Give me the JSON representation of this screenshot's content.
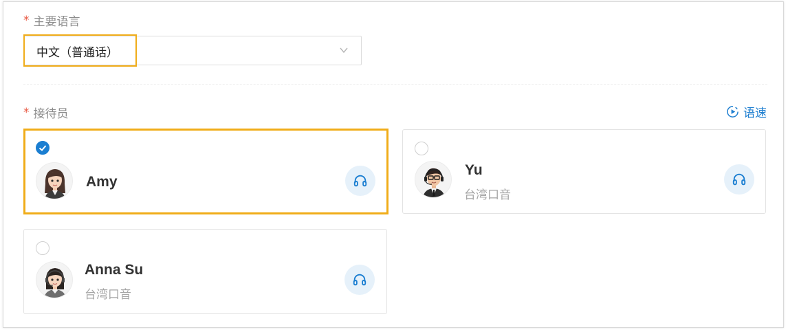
{
  "language": {
    "label": "主要语言",
    "required_mark": "*",
    "selected": "中文（普通话）"
  },
  "receptionist": {
    "label": "接待员",
    "required_mark": "*",
    "speed_label": "语速",
    "agents": [
      {
        "name": "Amy",
        "accent": "",
        "selected": true
      },
      {
        "name": "Yu",
        "accent": "台湾口音",
        "selected": false
      },
      {
        "name": "Anna Su",
        "accent": "台湾口音",
        "selected": false
      }
    ]
  },
  "colors": {
    "accent_blue": "#1b7ed1",
    "highlight_orange": "#f0ac18",
    "required_red": "#e8553f"
  }
}
